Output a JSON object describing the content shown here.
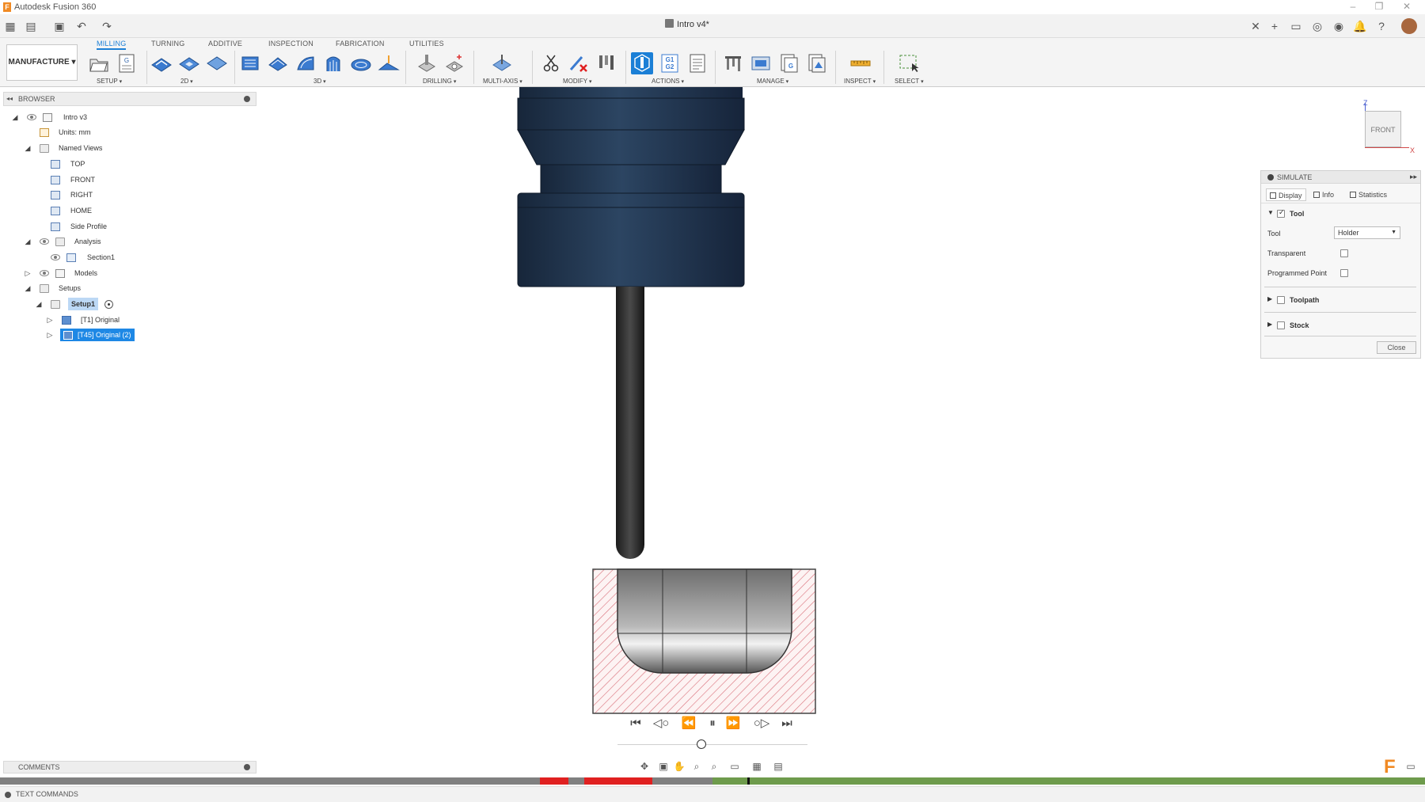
{
  "app": {
    "title": "Autodesk Fusion 360",
    "logo_letter": "F"
  },
  "document": {
    "tab_title": "Intro v4*"
  },
  "workspace": {
    "label": "MANUFACTURE ▾"
  },
  "ribbon": {
    "tabs": [
      "MILLING",
      "TURNING",
      "ADDITIVE",
      "INSPECTION",
      "FABRICATION",
      "UTILITIES"
    ],
    "active_tab": "MILLING",
    "groups": [
      "SETUP",
      "2D",
      "3D",
      "DRILLING",
      "MULTI-AXIS",
      "MODIFY",
      "ACTIONS",
      "MANAGE",
      "INSPECT",
      "SELECT"
    ],
    "actions_g1g2_top": "G1",
    "actions_g1g2_bottom": "G2",
    "setup_g_label": "G"
  },
  "browser": {
    "header": "BROWSER",
    "items": [
      {
        "label": "Intro v3"
      },
      {
        "label": "Units: mm"
      },
      {
        "label": "Named Views"
      },
      {
        "label": "TOP"
      },
      {
        "label": "FRONT"
      },
      {
        "label": "RIGHT"
      },
      {
        "label": "HOME"
      },
      {
        "label": "Side Profile"
      },
      {
        "label": "Analysis"
      },
      {
        "label": "Section1"
      },
      {
        "label": "Models"
      },
      {
        "label": "Setups"
      },
      {
        "label": "Setup1"
      },
      {
        "label": "[T1] Original"
      },
      {
        "label": "[T45] Original (2)"
      }
    ]
  },
  "viewcube": {
    "face": "FRONT",
    "axis_z": "Z",
    "axis_x": "X"
  },
  "simulate": {
    "title": "SIMULATE",
    "tabs": [
      "Display",
      "Info",
      "Statistics"
    ],
    "tool_section": "Tool",
    "tool_label": "Tool",
    "tool_value": "Holder",
    "transparent_label": "Transparent",
    "programmed_point_label": "Programmed Point",
    "toolpath_section": "Toolpath",
    "stock_section": "Stock",
    "close_label": "Close"
  },
  "playback": {
    "position": 0.56
  },
  "comments": {
    "header": "COMMENTS"
  },
  "text_commands": {
    "label": "TEXT COMMANDS"
  },
  "colors": {
    "accent": "#1b7fd6",
    "holder": "#1f3249",
    "timeline_green": "#6e9b4c",
    "timeline_red": "#e02020",
    "stock_hatch": "#d9707a"
  }
}
